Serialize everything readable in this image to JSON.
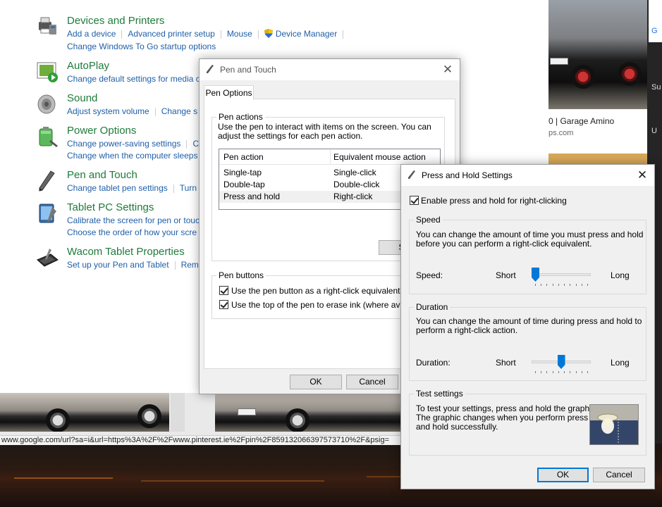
{
  "browser": {
    "status_url": "www.google.com/url?sa=i&url=https%3A%2F%2Fwww.pinterest.ie%2Fpin%2F859132066397573710%2F&psig=",
    "result_title": "0 | Garage Amino",
    "result_site": "ps.com",
    "right_panel": [
      "G",
      "Su",
      "U"
    ]
  },
  "control_panel": {
    "items": [
      {
        "title": "Devices and Printers",
        "links_row1": [
          "Add a device",
          "Advanced printer setup",
          "Mouse",
          "Device Manager"
        ],
        "links_row2": [
          "Change Windows To Go startup options"
        ]
      },
      {
        "title": "AutoPlay",
        "links_row1": [
          "Change default settings for media c"
        ]
      },
      {
        "title": "Sound",
        "links_row1": [
          "Adjust system volume",
          "Change s"
        ]
      },
      {
        "title": "Power Options",
        "links_row1": [
          "Change power-saving settings",
          "C"
        ],
        "links_row2": [
          "Change when the computer sleeps"
        ]
      },
      {
        "title": "Pen and Touch",
        "links_row1": [
          "Change tablet pen settings",
          "Turn"
        ]
      },
      {
        "title": "Tablet PC Settings",
        "links_row1": [
          "Calibrate the screen for pen or touc"
        ],
        "links_row2": [
          "Choose the order of how your scre"
        ]
      },
      {
        "title": "Wacom Tablet Properties",
        "links_row1": [
          "Set up your Pen and Tablet",
          "Rem"
        ]
      }
    ]
  },
  "pen_touch": {
    "title": "Pen and Touch",
    "close": "✕",
    "tab": "Pen Options",
    "pen_actions_label": "Pen actions",
    "pen_actions_desc": "Use the pen to interact with items on the screen.  You can adjust the settings for each pen action.",
    "col_action": "Pen action",
    "col_mouse": "Equivalent mouse action",
    "rows": [
      {
        "action": "Single-tap",
        "mouse": "Single-click"
      },
      {
        "action": "Double-tap",
        "mouse": "Double-click"
      },
      {
        "action": "Press and hold",
        "mouse": "Right-click"
      }
    ],
    "settings_btn": "Set",
    "pen_buttons_label": "Pen buttons",
    "chk1": "Use the pen button as a right-click equivalent",
    "chk2": "Use the top of the pen to erase ink (where availab",
    "ok": "OK",
    "cancel": "Cancel"
  },
  "press_hold": {
    "title": "Press and Hold Settings",
    "close": "✕",
    "enable_label": "Enable press and hold for right-clicking",
    "speed_label": "Speed",
    "speed_desc1": "You can change the amount of time you must press and hold",
    "speed_desc2": "before you can perform a right-click equivalent.",
    "speed_row_label": "Speed:",
    "speed_value": 0.0,
    "duration_label": "Duration",
    "duration_desc1": "You can change the amount of time during press and hold to",
    "duration_desc2": "perform a right-click action.",
    "duration_row_label": "Duration:",
    "duration_value": 0.5,
    "short": "Short",
    "long": "Long",
    "test_label": "Test settings",
    "test_desc1": "To test your settings, press and hold the graphic.",
    "test_desc2": "The graphic changes when you perform press",
    "test_desc3": "and hold successfully.",
    "ok": "OK",
    "cancel": "Cancel"
  },
  "colors": {
    "link": "#1f5fa8",
    "heading": "#1e7b3b",
    "accent": "#0078d7"
  }
}
